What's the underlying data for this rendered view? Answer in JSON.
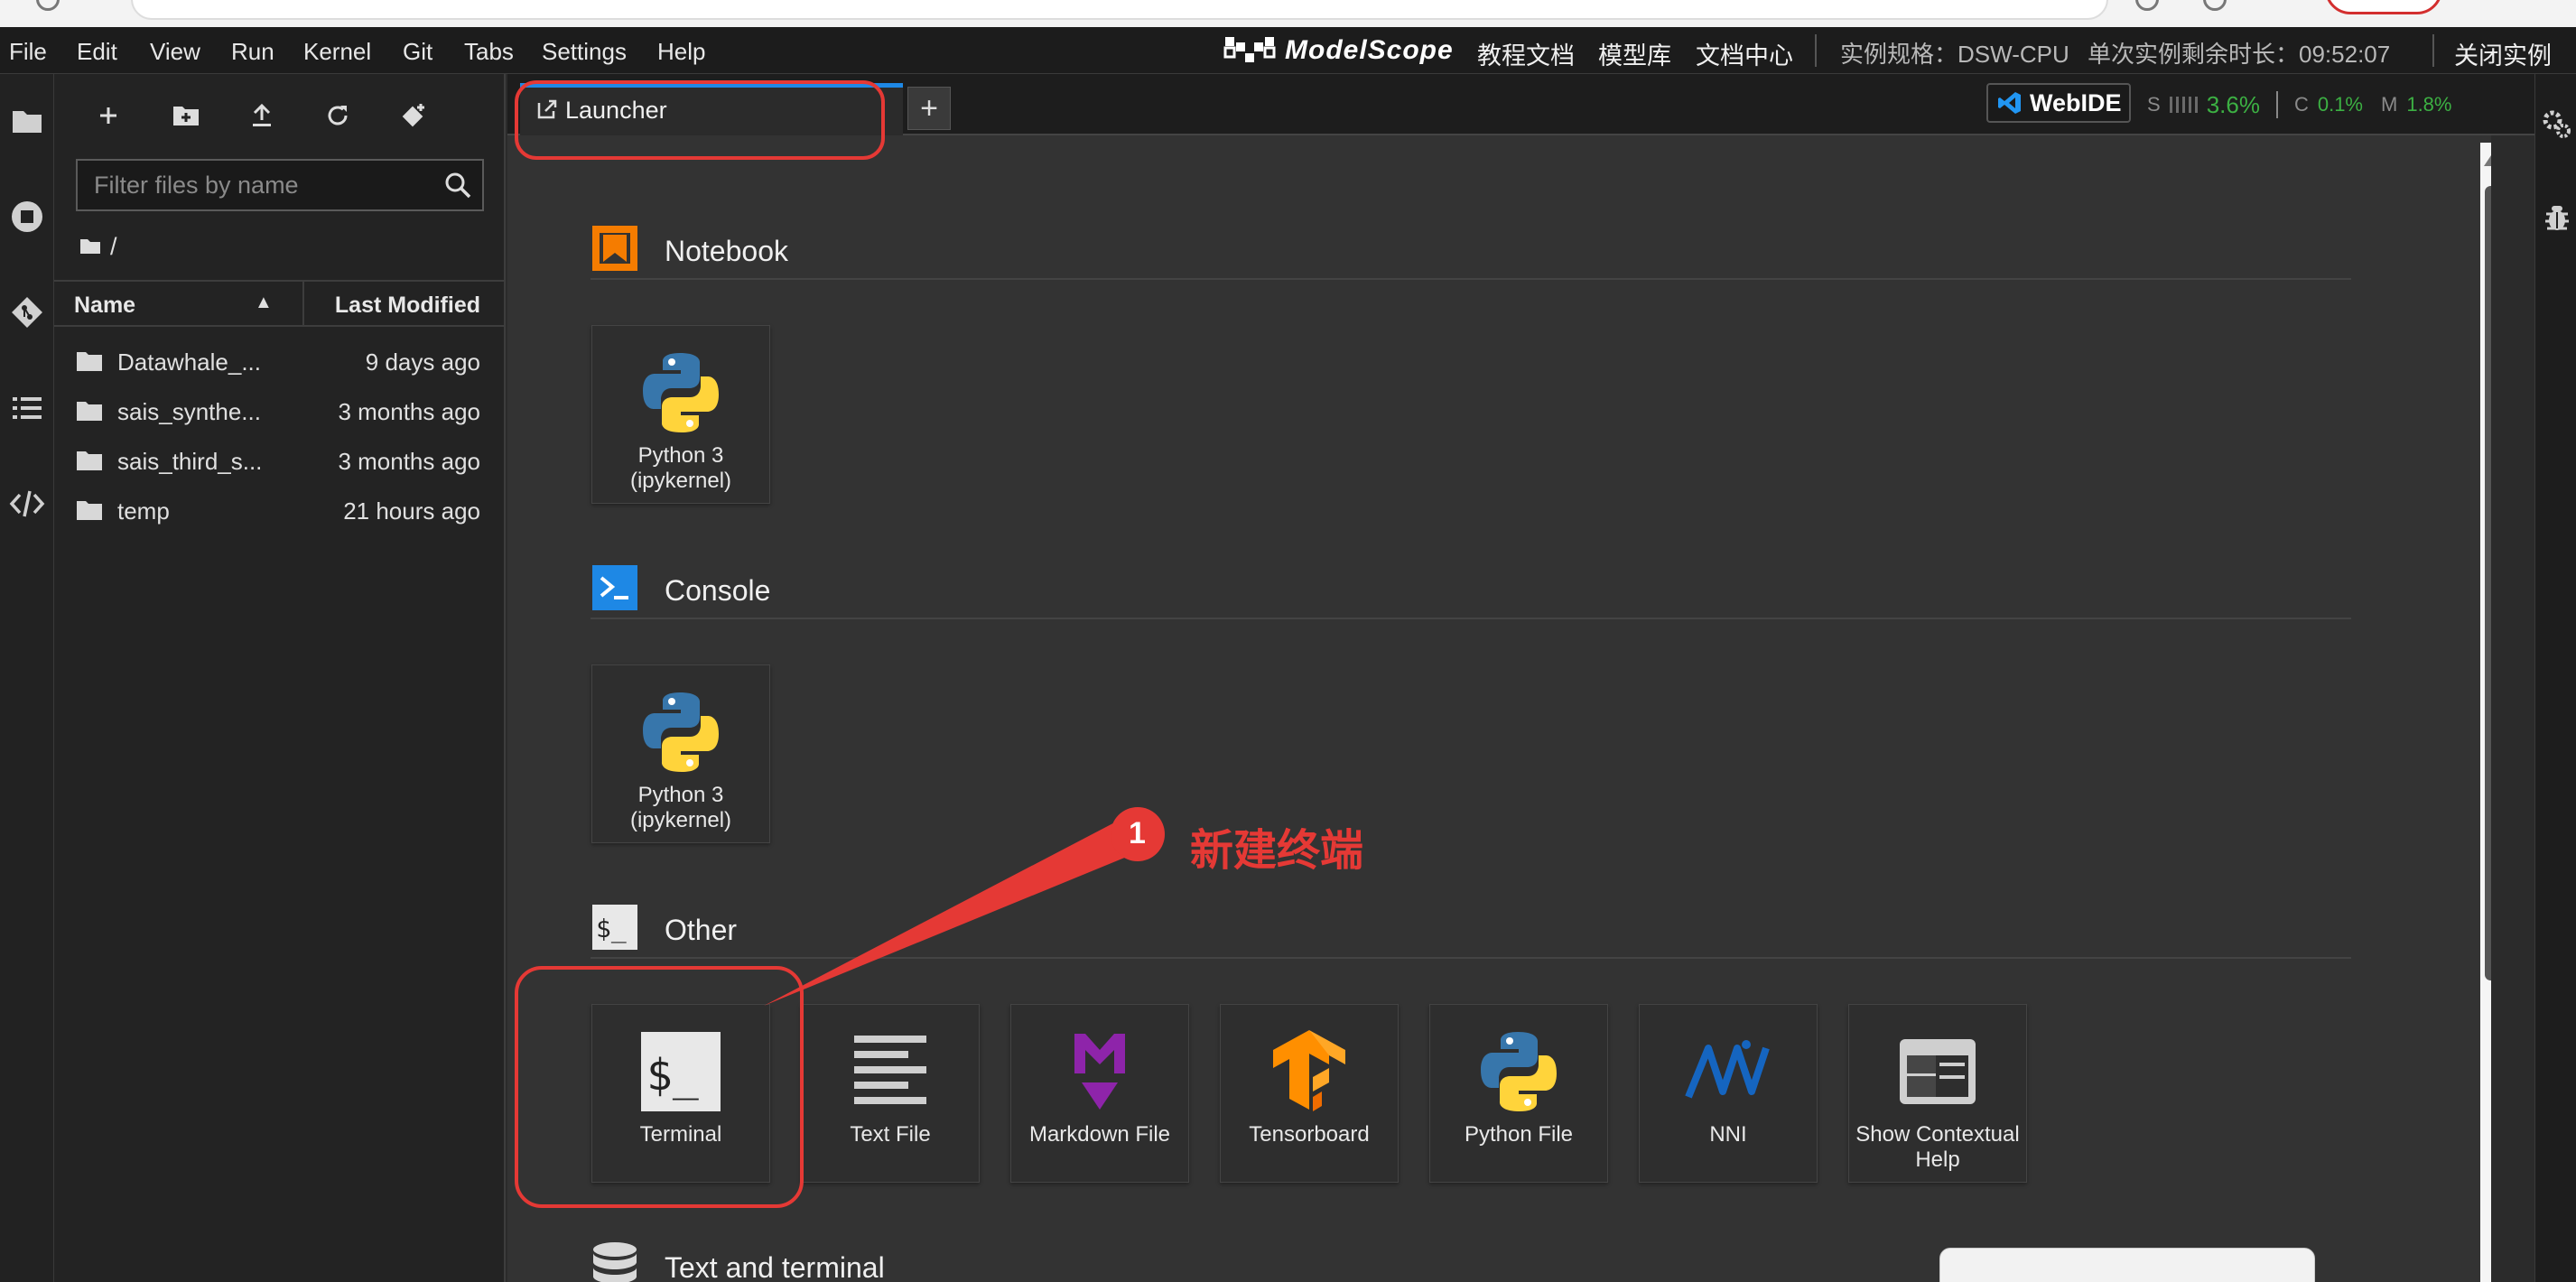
{
  "menubar": {
    "items": [
      "File",
      "Edit",
      "View",
      "Run",
      "Kernel",
      "Git",
      "Tabs",
      "Settings",
      "Help"
    ],
    "brand": "ModelScope",
    "links": [
      "教程文档",
      "模型库",
      "文档中心"
    ],
    "instance_spec": "实例规格：DSW-CPU",
    "remaining_time": "单次实例剩余时长：09:52:07",
    "close_instance": "关闭实例"
  },
  "filebrowser": {
    "toolbar": [
      "new-launcher",
      "new-folder",
      "upload",
      "refresh",
      "git-clone"
    ],
    "filter_placeholder": "Filter files by name",
    "breadcrumb": "/",
    "col_name": "Name",
    "col_modified": "Last Modified",
    "rows": [
      {
        "name": "Datawhale_...",
        "modified": "9 days ago"
      },
      {
        "name": "sais_synthe...",
        "modified": "3 months ago"
      },
      {
        "name": "sais_third_s...",
        "modified": "3 months ago"
      },
      {
        "name": "temp",
        "modified": "21 hours ago"
      }
    ]
  },
  "tabs": {
    "launcher_label": "Launcher",
    "add_label": "+"
  },
  "webide": {
    "label": "WebIDE"
  },
  "status": {
    "s_key": "S",
    "s_val": "3.6%",
    "c_key": "C",
    "c_val": "0.1%",
    "m_key": "M",
    "m_val": "1.8%"
  },
  "launcher": {
    "notebook": {
      "title": "Notebook",
      "cards": [
        {
          "label": "Python 3 (ipykernel)",
          "icon": "python-icon"
        }
      ]
    },
    "console": {
      "title": "Console",
      "cards": [
        {
          "label": "Python 3 (ipykernel)",
          "icon": "python-icon"
        }
      ]
    },
    "other": {
      "title": "Other",
      "cards": [
        {
          "label": "Terminal",
          "icon": "terminal-icon"
        },
        {
          "label": "Text File",
          "icon": "text-file-icon"
        },
        {
          "label": "Markdown File",
          "icon": "markdown-icon"
        },
        {
          "label": "Tensorboard",
          "icon": "tensorboard-icon"
        },
        {
          "label": "Python File",
          "icon": "python-icon"
        },
        {
          "label": "NNI",
          "icon": "nni-icon"
        },
        {
          "label": "Show Contextual Help",
          "icon": "contextual-help-icon"
        }
      ]
    },
    "text_and_terminal": {
      "title": "Text and terminal"
    }
  },
  "annotation": {
    "number": "1",
    "label": "新建终端",
    "color": "#e53935"
  },
  "colors": {
    "accent": "#1e88e5",
    "status_green": "#3cb043",
    "notebook_orange": "#f57c00",
    "console_blue": "#1e88e5",
    "annotation_red": "#e53935"
  }
}
